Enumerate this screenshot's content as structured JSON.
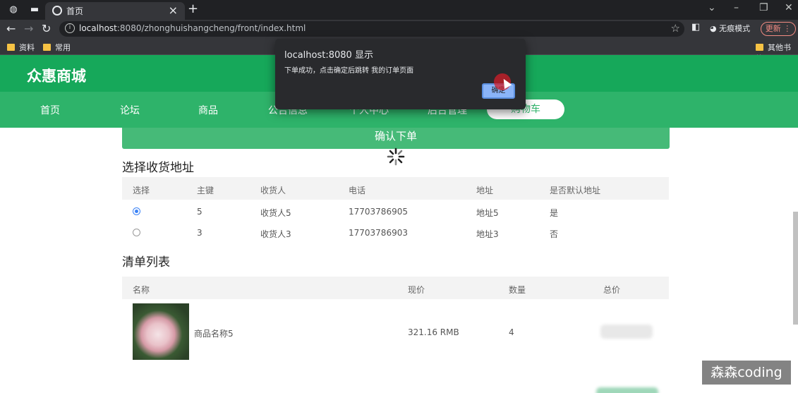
{
  "browser": {
    "tab_title": "首页",
    "url_host": "localhost",
    "url_rest": ":8080/zhonghuishangcheng/front/index.html",
    "incognito_label": "无痕模式",
    "update_label": "更新",
    "bookmarks": [
      "资料",
      "常用"
    ],
    "other_bookmarks": "其他书签"
  },
  "site": {
    "logo": "众惠商城",
    "nav": [
      "首页",
      "论坛",
      "商品",
      "公告信息",
      "个人中心",
      "后台管理",
      "购物车"
    ]
  },
  "checkout": {
    "confirm_label": "确认下单",
    "address_title": "选择收货地址",
    "address_headers": [
      "选择",
      "主键",
      "收货人",
      "电话",
      "地址",
      "是否默认地址"
    ],
    "addresses": [
      {
        "selected": true,
        "id": "5",
        "name": "收货人5",
        "phone": "17703786905",
        "address": "地址5",
        "default": "是"
      },
      {
        "selected": false,
        "id": "3",
        "name": "收货人3",
        "phone": "17703786903",
        "address": "地址3",
        "default": "否"
      }
    ],
    "list_title": "清单列表",
    "list_headers": [
      "名称",
      "现价",
      "数量",
      "总价"
    ],
    "items": [
      {
        "name": "商品名称5",
        "price": "321.16 RMB",
        "qty": "4"
      }
    ]
  },
  "alert": {
    "title": "localhost:8080 显示",
    "message": "下单成功，点击确定后跳转 我的订单页面",
    "ok_label": "确定"
  },
  "watermark": "森森coding"
}
